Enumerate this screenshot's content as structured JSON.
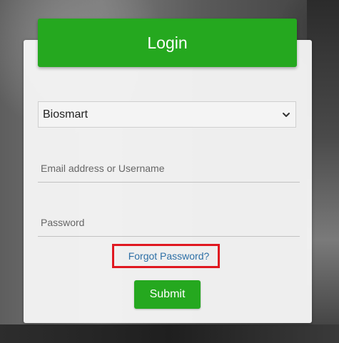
{
  "header": {
    "title": "Login"
  },
  "form": {
    "organization_select": {
      "value": "Biosmart",
      "icon": "chevron-down-icon"
    },
    "email_field": {
      "placeholder": "Email address or Username",
      "value": ""
    },
    "password_field": {
      "placeholder": "Password",
      "value": ""
    },
    "forgot_password_label": "Forgot Password?",
    "submit_label": "Submit"
  },
  "colors": {
    "accent_green": "#25a81f",
    "link_blue": "#2d6fa6",
    "highlight_red": "#e01820"
  }
}
